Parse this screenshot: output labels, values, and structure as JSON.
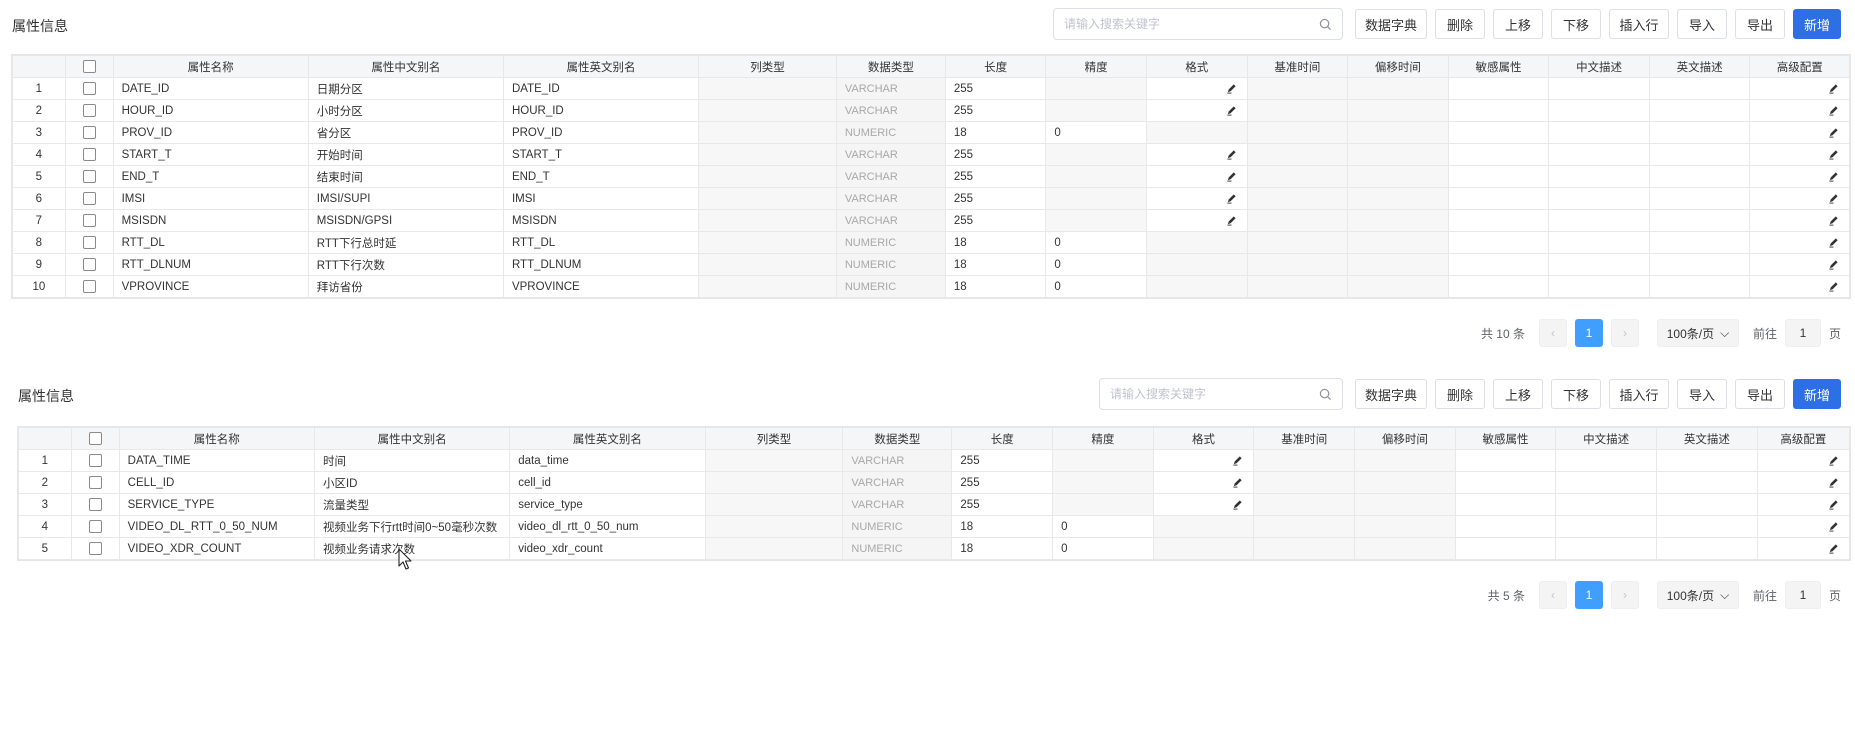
{
  "sections": [
    {
      "title": "属性信息",
      "search_placeholder": "请输入搜索关键字",
      "buttons": {
        "dict": "数据字典",
        "delete": "删除",
        "up": "上移",
        "down": "下移",
        "insert": "插入行",
        "import": "导入",
        "export": "导出",
        "add": "新增"
      },
      "columns": [
        "属性名称",
        "属性中文别名",
        "属性英文别名",
        "列类型",
        "数据类型",
        "长度",
        "精度",
        "格式",
        "基准时间",
        "偏移时间",
        "敏感属性",
        "中文描述",
        "英文描述",
        "高级配置"
      ],
      "rows": [
        {
          "idx": "1",
          "name": "DATE_ID",
          "cn": "日期分区",
          "en": "DATE_ID",
          "dtype": "VARCHAR",
          "len": "255",
          "prec": "",
          "fmt_edit": true
        },
        {
          "idx": "2",
          "name": "HOUR_ID",
          "cn": "小时分区",
          "en": "HOUR_ID",
          "dtype": "VARCHAR",
          "len": "255",
          "prec": "",
          "fmt_edit": true
        },
        {
          "idx": "3",
          "name": "PROV_ID",
          "cn": "省分区",
          "en": "PROV_ID",
          "dtype": "NUMERIC",
          "len": "18",
          "prec": "0",
          "fmt_edit": false
        },
        {
          "idx": "4",
          "name": "START_T",
          "cn": "开始时间",
          "en": "START_T",
          "dtype": "VARCHAR",
          "len": "255",
          "prec": "",
          "fmt_edit": true
        },
        {
          "idx": "5",
          "name": "END_T",
          "cn": "结束时间",
          "en": "END_T",
          "dtype": "VARCHAR",
          "len": "255",
          "prec": "",
          "fmt_edit": true
        },
        {
          "idx": "6",
          "name": "IMSI",
          "cn": "IMSI/SUPI",
          "en": "IMSI",
          "dtype": "VARCHAR",
          "len": "255",
          "prec": "",
          "fmt_edit": true
        },
        {
          "idx": "7",
          "name": "MSISDN",
          "cn": "MSISDN/GPSI",
          "en": "MSISDN",
          "dtype": "VARCHAR",
          "len": "255",
          "prec": "",
          "fmt_edit": true
        },
        {
          "idx": "8",
          "name": "RTT_DL",
          "cn": "RTT下行总时延",
          "en": "RTT_DL",
          "dtype": "NUMERIC",
          "len": "18",
          "prec": "0",
          "fmt_edit": false
        },
        {
          "idx": "9",
          "name": "RTT_DLNUM",
          "cn": "RTT下行次数",
          "en": "RTT_DLNUM",
          "dtype": "NUMERIC",
          "len": "18",
          "prec": "0",
          "fmt_edit": false
        },
        {
          "idx": "10",
          "name": "VPROVINCE",
          "cn": "拜访省份",
          "en": "VPROVINCE",
          "dtype": "NUMERIC",
          "len": "18",
          "prec": "0",
          "fmt_edit": false
        }
      ],
      "pager": {
        "total": "共 10 条",
        "page": "1",
        "size": "100条/页",
        "goto": "前往",
        "goto_value": "1",
        "page_suffix": "页"
      }
    },
    {
      "title": "属性信息",
      "search_placeholder": "请输入搜索关键字",
      "buttons": {
        "dict": "数据字典",
        "delete": "删除",
        "up": "上移",
        "down": "下移",
        "insert": "插入行",
        "import": "导入",
        "export": "导出",
        "add": "新增"
      },
      "columns": [
        "属性名称",
        "属性中文别名",
        "属性英文别名",
        "列类型",
        "数据类型",
        "长度",
        "精度",
        "格式",
        "基准时间",
        "偏移时间",
        "敏感属性",
        "中文描述",
        "英文描述",
        "高级配置"
      ],
      "rows": [
        {
          "idx": "1",
          "name": "DATA_TIME",
          "cn": "时间",
          "en": "data_time",
          "dtype": "VARCHAR",
          "len": "255",
          "prec": "",
          "fmt_edit": true
        },
        {
          "idx": "2",
          "name": "CELL_ID",
          "cn": "小区ID",
          "en": "cell_id",
          "dtype": "VARCHAR",
          "len": "255",
          "prec": "",
          "fmt_edit": true
        },
        {
          "idx": "3",
          "name": "SERVICE_TYPE",
          "cn": "流量类型",
          "en": "service_type",
          "dtype": "VARCHAR",
          "len": "255",
          "prec": "",
          "fmt_edit": true
        },
        {
          "idx": "4",
          "name": "VIDEO_DL_RTT_0_50_NUM",
          "cn": "视频业务下行rtt时间0~50毫秒次数",
          "en": "video_dl_rtt_0_50_num",
          "dtype": "NUMERIC",
          "len": "18",
          "prec": "0",
          "fmt_edit": false
        },
        {
          "idx": "5",
          "name": "VIDEO_XDR_COUNT",
          "cn": "视频业务请求次数",
          "en": "video_xdr_count",
          "dtype": "NUMERIC",
          "len": "18",
          "prec": "0",
          "fmt_edit": false
        }
      ],
      "pager": {
        "total": "共 5 条",
        "page": "1",
        "size": "100条/页",
        "goto": "前往",
        "goto_value": "1",
        "page_suffix": "页"
      }
    }
  ],
  "icons": {
    "search": "search-icon",
    "edit": "pencil-icon",
    "prev": "chevron-left-icon",
    "next": "chevron-right-icon",
    "dropdown": "chevron-down-icon",
    "cursor": "mouse-cursor-icon"
  },
  "colors": {
    "primary": "#2f6fe6",
    "page_active": "#409eff",
    "header_bg": "#f5f6f8",
    "readonly_bg": "#f7f7f7",
    "dtype_text": "#a8a8a8"
  }
}
